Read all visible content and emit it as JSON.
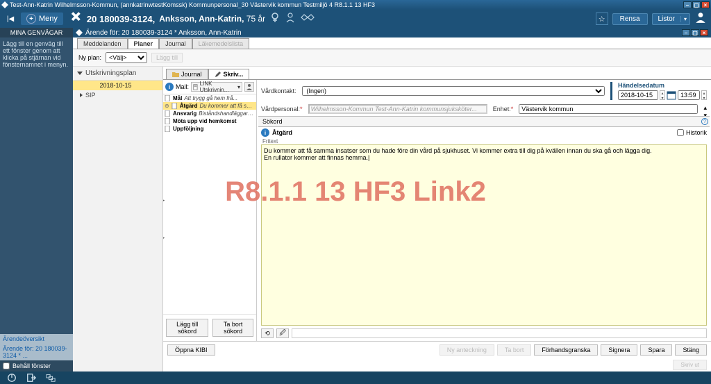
{
  "titlebar": "Test-Ann-Katrin  Wilhelmsson-Kommun, (annkatrinwtestKomssk) Kommunpersonal_30 Västervik kommun Testmiljö 4 R8.1.1 13 HF3",
  "toolbar": {
    "meny": "Meny",
    "patient_id": "20 180039-3124,",
    "patient_name": "Anksson, Ann-Katrin,",
    "patient_age": "75 år",
    "rensa": "Rensa",
    "listor": "Listor"
  },
  "leftSidebar": {
    "header": "MINA GENVÄGAR",
    "hint": "Lägg till en genväg till ett fönster genom att klicka på stjärnan vid fönsternamnet i menyn.",
    "links_header": "Ärendeöversikt",
    "links_item": "Ärende för: 20 180039-3124 * ...",
    "keep_window": "Behåll fönster"
  },
  "arendeBar": "Ärende för: 20 180039-3124 * Anksson, Ann-Katrin",
  "tabs": [
    "Meddelanden",
    "Planer",
    "Journal",
    "Läkemedelslista"
  ],
  "nyplan": {
    "label": "Ny plan:",
    "select": "<Välj>",
    "button": "Lägg till"
  },
  "tree": {
    "header": "Utskrivningsplan",
    "date": "2018-10-15",
    "sip": "SIP"
  },
  "jtabs": [
    "Journal",
    "Skriv..."
  ],
  "mall": {
    "label": "Mall:",
    "selected": "LINK Utskrivnin..."
  },
  "goals": [
    {
      "label": "Mål",
      "val": "Att trygg gå hem frå..."
    },
    {
      "label": "Åtgärd",
      "val": "Du kommer att få sam..."
    },
    {
      "label": "Ansvarig",
      "val": "Biståndshandläggare ..."
    },
    {
      "label": "Möta upp vid hemkomst",
      "val": ""
    },
    {
      "label": "Uppföljning",
      "val": ""
    }
  ],
  "meta": {
    "vardkontakt_lbl": "Vårdkontakt:",
    "vardkontakt": "(Ingen)",
    "handelse_lbl": "Händelsedatum",
    "date": "2018-10-15",
    "time": "13:59",
    "vardpersonal_lbl": "Vårdpersonal:",
    "vardpersonal": "Wilhelmsson-Kommun Test-Ann-Katrin kommunsjuksköter...",
    "enhet_lbl": "Enhet:",
    "enhet": "Västervik kommun"
  },
  "sokord": {
    "header": "Sökord",
    "atgard": "Åtgärd",
    "historik": "Historik",
    "fritext_lbl": "Fritext"
  },
  "note_text": "Du kommer att få samma insatser som du hade före din vård på sjukhuset. Vi kommer extra till dig på kvällen innan du ska gå och lägga dig.\nEn rullator kommer att finnas hemma.|",
  "goal_buttons": {
    "add": "Lägg till sökord",
    "remove": "Ta bort sökord"
  },
  "footer": {
    "open": "Öppna KIBI",
    "ny": "Ny anteckning",
    "tabort": "Ta bort",
    "forhand": "Förhandsgranska",
    "signera": "Signera",
    "spara": "Spara",
    "stang": "Stäng",
    "skrivut": "Skriv ut"
  },
  "watermark": "R8.1.1 13 HF3 Link2"
}
